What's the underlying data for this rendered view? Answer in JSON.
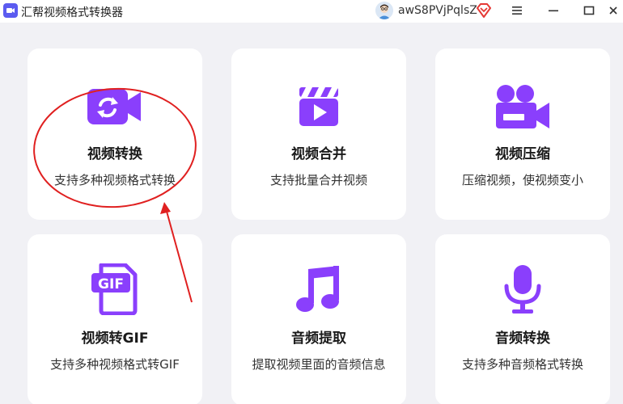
{
  "app": {
    "title": "汇帮视频格式转换器"
  },
  "user": {
    "name": "awS8PVjPqlsZ"
  },
  "colors": {
    "accent": "#8a3ffc",
    "annotation": "#e02020",
    "background": "#f1f1f5"
  },
  "window_controls": [
    "menu-icon",
    "minimize-icon",
    "maximize-icon",
    "close-icon"
  ],
  "cards": [
    {
      "icon": "video-convert-icon",
      "title": "视频转换",
      "desc": "支持多种视频格式转换"
    },
    {
      "icon": "clapperboard-icon",
      "title": "视频合并",
      "desc": "支持批量合并视频"
    },
    {
      "icon": "video-camera-icon",
      "title": "视频压缩",
      "desc": "压缩视频，使视频变小"
    },
    {
      "icon": "gif-icon",
      "title": "视频转GIF",
      "desc": "支持多种视频格式转GIF"
    },
    {
      "icon": "music-note-icon",
      "title": "音频提取",
      "desc": "提取视频里面的音频信息"
    },
    {
      "icon": "microphone-icon",
      "title": "音频转换",
      "desc": "支持多种音频格式转换"
    }
  ]
}
